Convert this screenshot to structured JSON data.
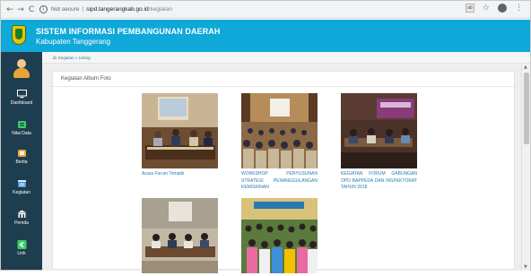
{
  "browser": {
    "back_icon": "arrow-left-icon",
    "forward_icon": "arrow-right-icon",
    "reload_icon": "reload-icon",
    "security_label": "Not secure",
    "url_host": "sipd.tangerangkab.go.id",
    "url_path": "/kegiatan"
  },
  "header": {
    "title": "SISTEM INFORMASI PEMBANGUNAN DAERAH",
    "subtitle": "Kabupaten Tanggerang",
    "bg_color": "#0fa8d8"
  },
  "sidebar": {
    "bg_color": "#1e3d4e",
    "items": [
      {
        "label": "Dashboard",
        "icon": "monitor-icon"
      },
      {
        "label": "Nilai Data",
        "icon": "database-icon"
      },
      {
        "label": "Berita",
        "icon": "news-icon"
      },
      {
        "label": "Kegiatan",
        "icon": "calendar-icon"
      },
      {
        "label": "Pemda",
        "icon": "building-icon"
      },
      {
        "label": "Link",
        "icon": "share-icon"
      }
    ]
  },
  "breadcrumb": {
    "text": "Kegiatan » Listing"
  },
  "panel": {
    "title": "Kegiatan Album Foto"
  },
  "albums": [
    {
      "caption": "Acara Forum Tematik",
      "photo": "meeting-table-photo"
    },
    {
      "caption": "WORKSHOP PENYUSUNAN STRATEGI PENANGGULANGAN KEMISKINAN",
      "photo": "workshop-hall-photo"
    },
    {
      "caption": "KEGIATAN FORUM GABUNGAN OPD BAPPEDA DAN INSPEKTORAT TAHUN 2018",
      "photo": "forum-stage-photo"
    },
    {
      "caption": "",
      "photo": "panel-meeting-photo"
    },
    {
      "caption": "",
      "photo": "crowd-photo"
    }
  ]
}
